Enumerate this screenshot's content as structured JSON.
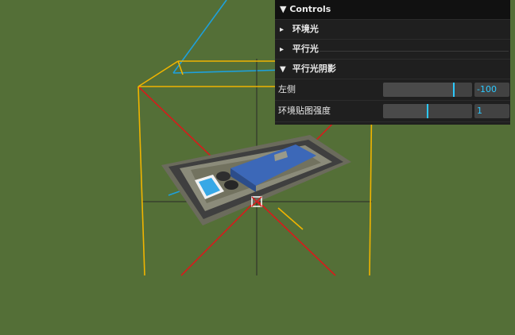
{
  "colors": {
    "ground": "#546f37",
    "camera_helper": "#f0b400",
    "camera_cross": "#d81b1b",
    "light_ray": "#1ea0dc",
    "axis": "#2a2a2a",
    "accent": "#2cc9ff"
  },
  "gui": {
    "title": "Controls",
    "folders": [
      {
        "label": "环境光",
        "state": "collapsed"
      },
      {
        "label": "平行光",
        "state": "collapsed"
      },
      {
        "label": "平行光阴影",
        "state": "expanded"
      }
    ],
    "controls": [
      {
        "label": "左侧",
        "value": "-100",
        "level_fraction": 0.8
      },
      {
        "label": "环境贴图强度",
        "value": "1",
        "level_fraction": 0.5
      }
    ]
  },
  "icons": {
    "expanded": "chevron-down-icon",
    "collapsed": "chevron-right-icon"
  }
}
